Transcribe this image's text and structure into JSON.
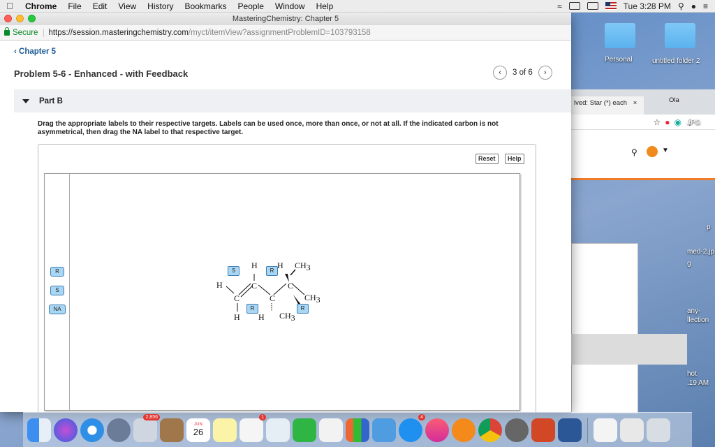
{
  "menubar": {
    "app": "Chrome",
    "items": [
      "File",
      "Edit",
      "View",
      "History",
      "Bookmarks",
      "People",
      "Window",
      "Help"
    ],
    "clock": "Tue 3:28 PM"
  },
  "window": {
    "title": "MasteringChemistry: Chapter 5",
    "secure_label": "Secure",
    "url_host": "https://session.masteringchemistry.com",
    "url_path": "/myct/itemView?assignmentProblemID=103793158"
  },
  "page": {
    "back_label": "Chapter 5",
    "problem_title": "Problem 5-6 - Enhanced - with Feedback",
    "pager": {
      "current": "3 of 6",
      "prev_icon": "chevron-left-icon",
      "next_icon": "chevron-right-icon"
    },
    "part_label": "Part B",
    "instructions": "Drag the appropriate labels to their respective targets. Labels can be used once, more than once, or not at all. If the indicated carbon is not asymmetrical, then drag the NA label to that respective target.",
    "reset_label": "Reset",
    "help_label": "Help",
    "labels": [
      "R",
      "S",
      "NA"
    ],
    "targets": [
      {
        "value": "S"
      },
      {
        "value": "R"
      },
      {
        "value": "R"
      },
      {
        "value": "R"
      }
    ],
    "molecule_atoms": {
      "h1": "H",
      "h2": "H",
      "h3": "H",
      "h4": "H",
      "h5": "H",
      "ch3_1": "CH",
      "ch3_1_sub": "3",
      "ch3_2": "CH",
      "ch3_2_sub": "3",
      "ch3_3": "CH",
      "ch3_3_sub": "3",
      "c1": "C",
      "c2": "C",
      "c3": "C",
      "c4": "C"
    }
  },
  "desktop": {
    "folders": [
      "Personal",
      "untitled folder 2"
    ],
    "labels": [
      "JPG",
      "med-2.jp",
      "g",
      "any-",
      "llection",
      "hot",
      ".19 AM",
      "p"
    ],
    "bg_tab": "lved: Star (*) each",
    "bg_tab_close": "×",
    "bg_tab2": "Ola"
  },
  "dock": {
    "badges": {
      "mail_count": "2,856",
      "calendar_day": "26",
      "calendar_month": "JUN",
      "reminder_count": "1",
      "appstore_count": "4"
    }
  }
}
